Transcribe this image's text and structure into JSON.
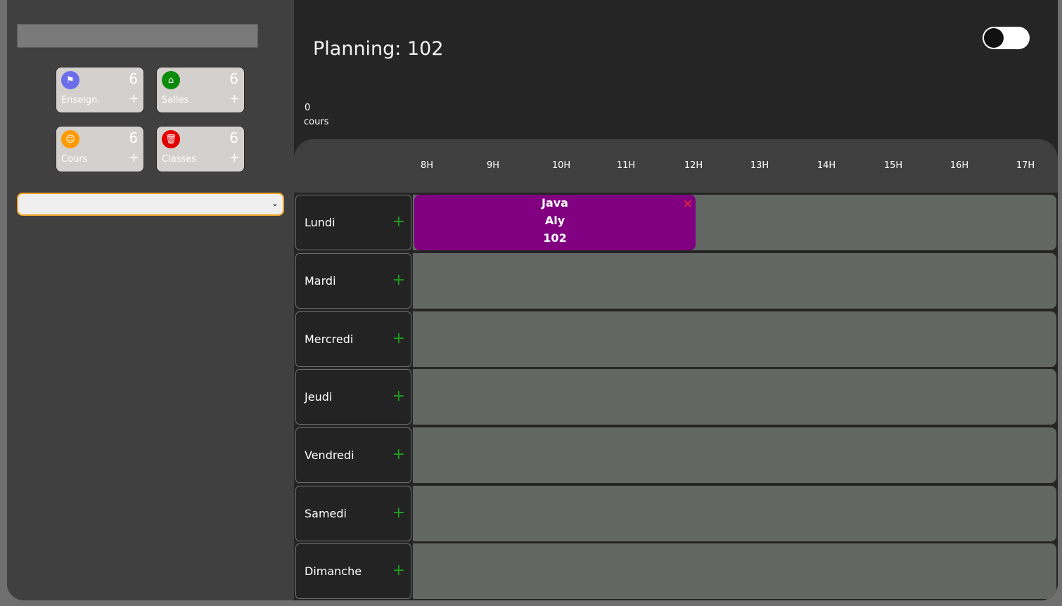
{
  "sidebar": {
    "search_value": "",
    "stats": [
      {
        "id": "enseign",
        "icon": "teacher-icon",
        "glyph": "⚑",
        "color": "#6b6dea",
        "count": "6",
        "label": "Enseign.",
        "add": "+"
      },
      {
        "id": "salles",
        "icon": "home-icon",
        "glyph": "⌂",
        "color": "#0b8a0b",
        "count": "6",
        "label": "Salles",
        "add": "+"
      },
      {
        "id": "cours",
        "icon": "group-icon",
        "glyph": "☺",
        "color": "#ff9a00",
        "count": "6",
        "label": "Cours",
        "add": "+"
      },
      {
        "id": "classes",
        "icon": "trash-icon",
        "glyph": "🗑",
        "color": "#e00000",
        "count": "6",
        "label": "Classes",
        "add": "+"
      }
    ],
    "select": {
      "value": "",
      "chevron": "⌄"
    }
  },
  "main": {
    "title": "Planning: 102",
    "toggle": {
      "state": "off"
    },
    "cours_count": "0",
    "cours_label": "cours",
    "hours": [
      "8H",
      "9H",
      "10H",
      "11H",
      "12H",
      "13H",
      "14H",
      "15H",
      "16H",
      "17H"
    ],
    "days": [
      {
        "name": "Lundi",
        "add": "+"
      },
      {
        "name": "Mardi",
        "add": "+"
      },
      {
        "name": "Mercredi",
        "add": "+"
      },
      {
        "name": "Jeudi",
        "add": "+"
      },
      {
        "name": "Vendredi",
        "add": "+"
      },
      {
        "name": "Samedi",
        "add": "+"
      },
      {
        "name": "Dimanche",
        "add": "+"
      }
    ],
    "events": [
      {
        "day": "Lundi",
        "subject": "Java",
        "teacher": "Aly",
        "room": "102",
        "color": "#810081",
        "close": "×",
        "start": "8H",
        "end": "12H"
      }
    ]
  }
}
